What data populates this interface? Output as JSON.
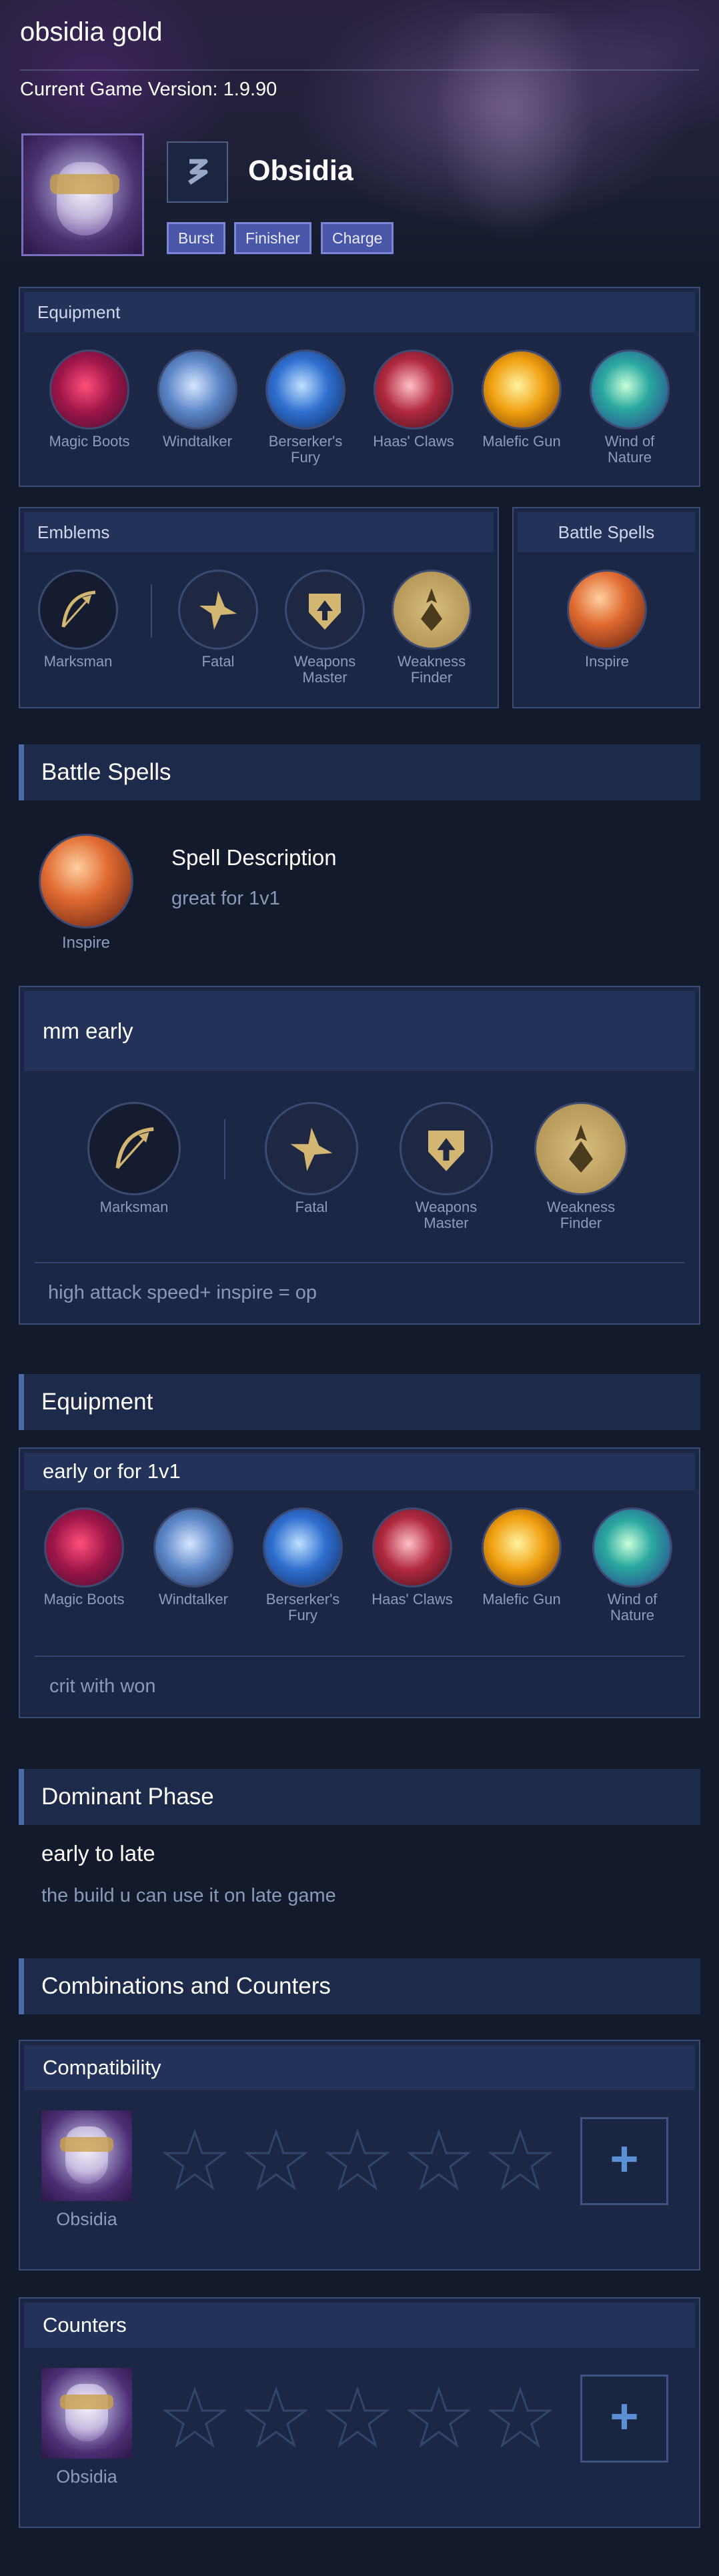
{
  "page": {
    "title": "obsidia gold",
    "version": "Current Game Version: 1.9.90"
  },
  "hero": {
    "name": "Obsidia",
    "tags": [
      "Burst",
      "Finisher",
      "Charge"
    ]
  },
  "equipment_panel": {
    "title": "Equipment",
    "items": [
      "Magic Boots",
      "Windtalker",
      "Berserker's Fury",
      "Haas' Claws",
      "Malefic Gun",
      "Wind of Nature"
    ]
  },
  "emblems_panel": {
    "title": "Emblems",
    "main": "Marksman",
    "talents": [
      "Fatal",
      "Weapons Master",
      "Weakness Finder"
    ]
  },
  "spells_panel": {
    "title": "Battle Spells",
    "spell": "Inspire"
  },
  "battle_spells_section": {
    "heading": "Battle Spells",
    "spell": "Inspire",
    "desc_title": "Spell Description",
    "desc_text": "great for 1v1"
  },
  "emblem_card": {
    "title": "mm early",
    "main": "Marksman",
    "talents": [
      "Fatal",
      "Weapons Master",
      "Weakness Finder"
    ],
    "note": "high attack speed+ inspire = op"
  },
  "equipment_section": {
    "heading": "Equipment",
    "card_title": "early or for 1v1",
    "items": [
      "Magic Boots",
      "Windtalker",
      "Berserker's Fury",
      "Haas' Claws",
      "Malefic Gun",
      "Wind of Nature"
    ],
    "note": "crit with won"
  },
  "dominant_phase": {
    "heading": "Dominant Phase",
    "phase": "early to late",
    "text": "the build u can use it on late game"
  },
  "combos": {
    "heading": "Combinations and Counters",
    "compatibility": {
      "title": "Compatibility",
      "hero": "Obsidia",
      "add": "+"
    },
    "counters": {
      "title": "Counters",
      "hero": "Obsidia",
      "add": "+"
    }
  },
  "colors": {
    "accent": "#4d6aa8",
    "gold": "#d4b673",
    "tag": "#4a56a8"
  },
  "icons": {
    "items": [
      "magic-boots-icon",
      "windtalker-icon",
      "berserkers-fury-icon",
      "haas-claws-icon",
      "malefic-gun-icon",
      "wind-of-nature-icon"
    ],
    "emblems": [
      "marksman-icon",
      "fatal-icon",
      "weapons-master-icon",
      "weakness-finder-icon"
    ],
    "spell": "inspire-icon",
    "role": "marksman-role-icon",
    "empty_slot": "star-icon"
  }
}
